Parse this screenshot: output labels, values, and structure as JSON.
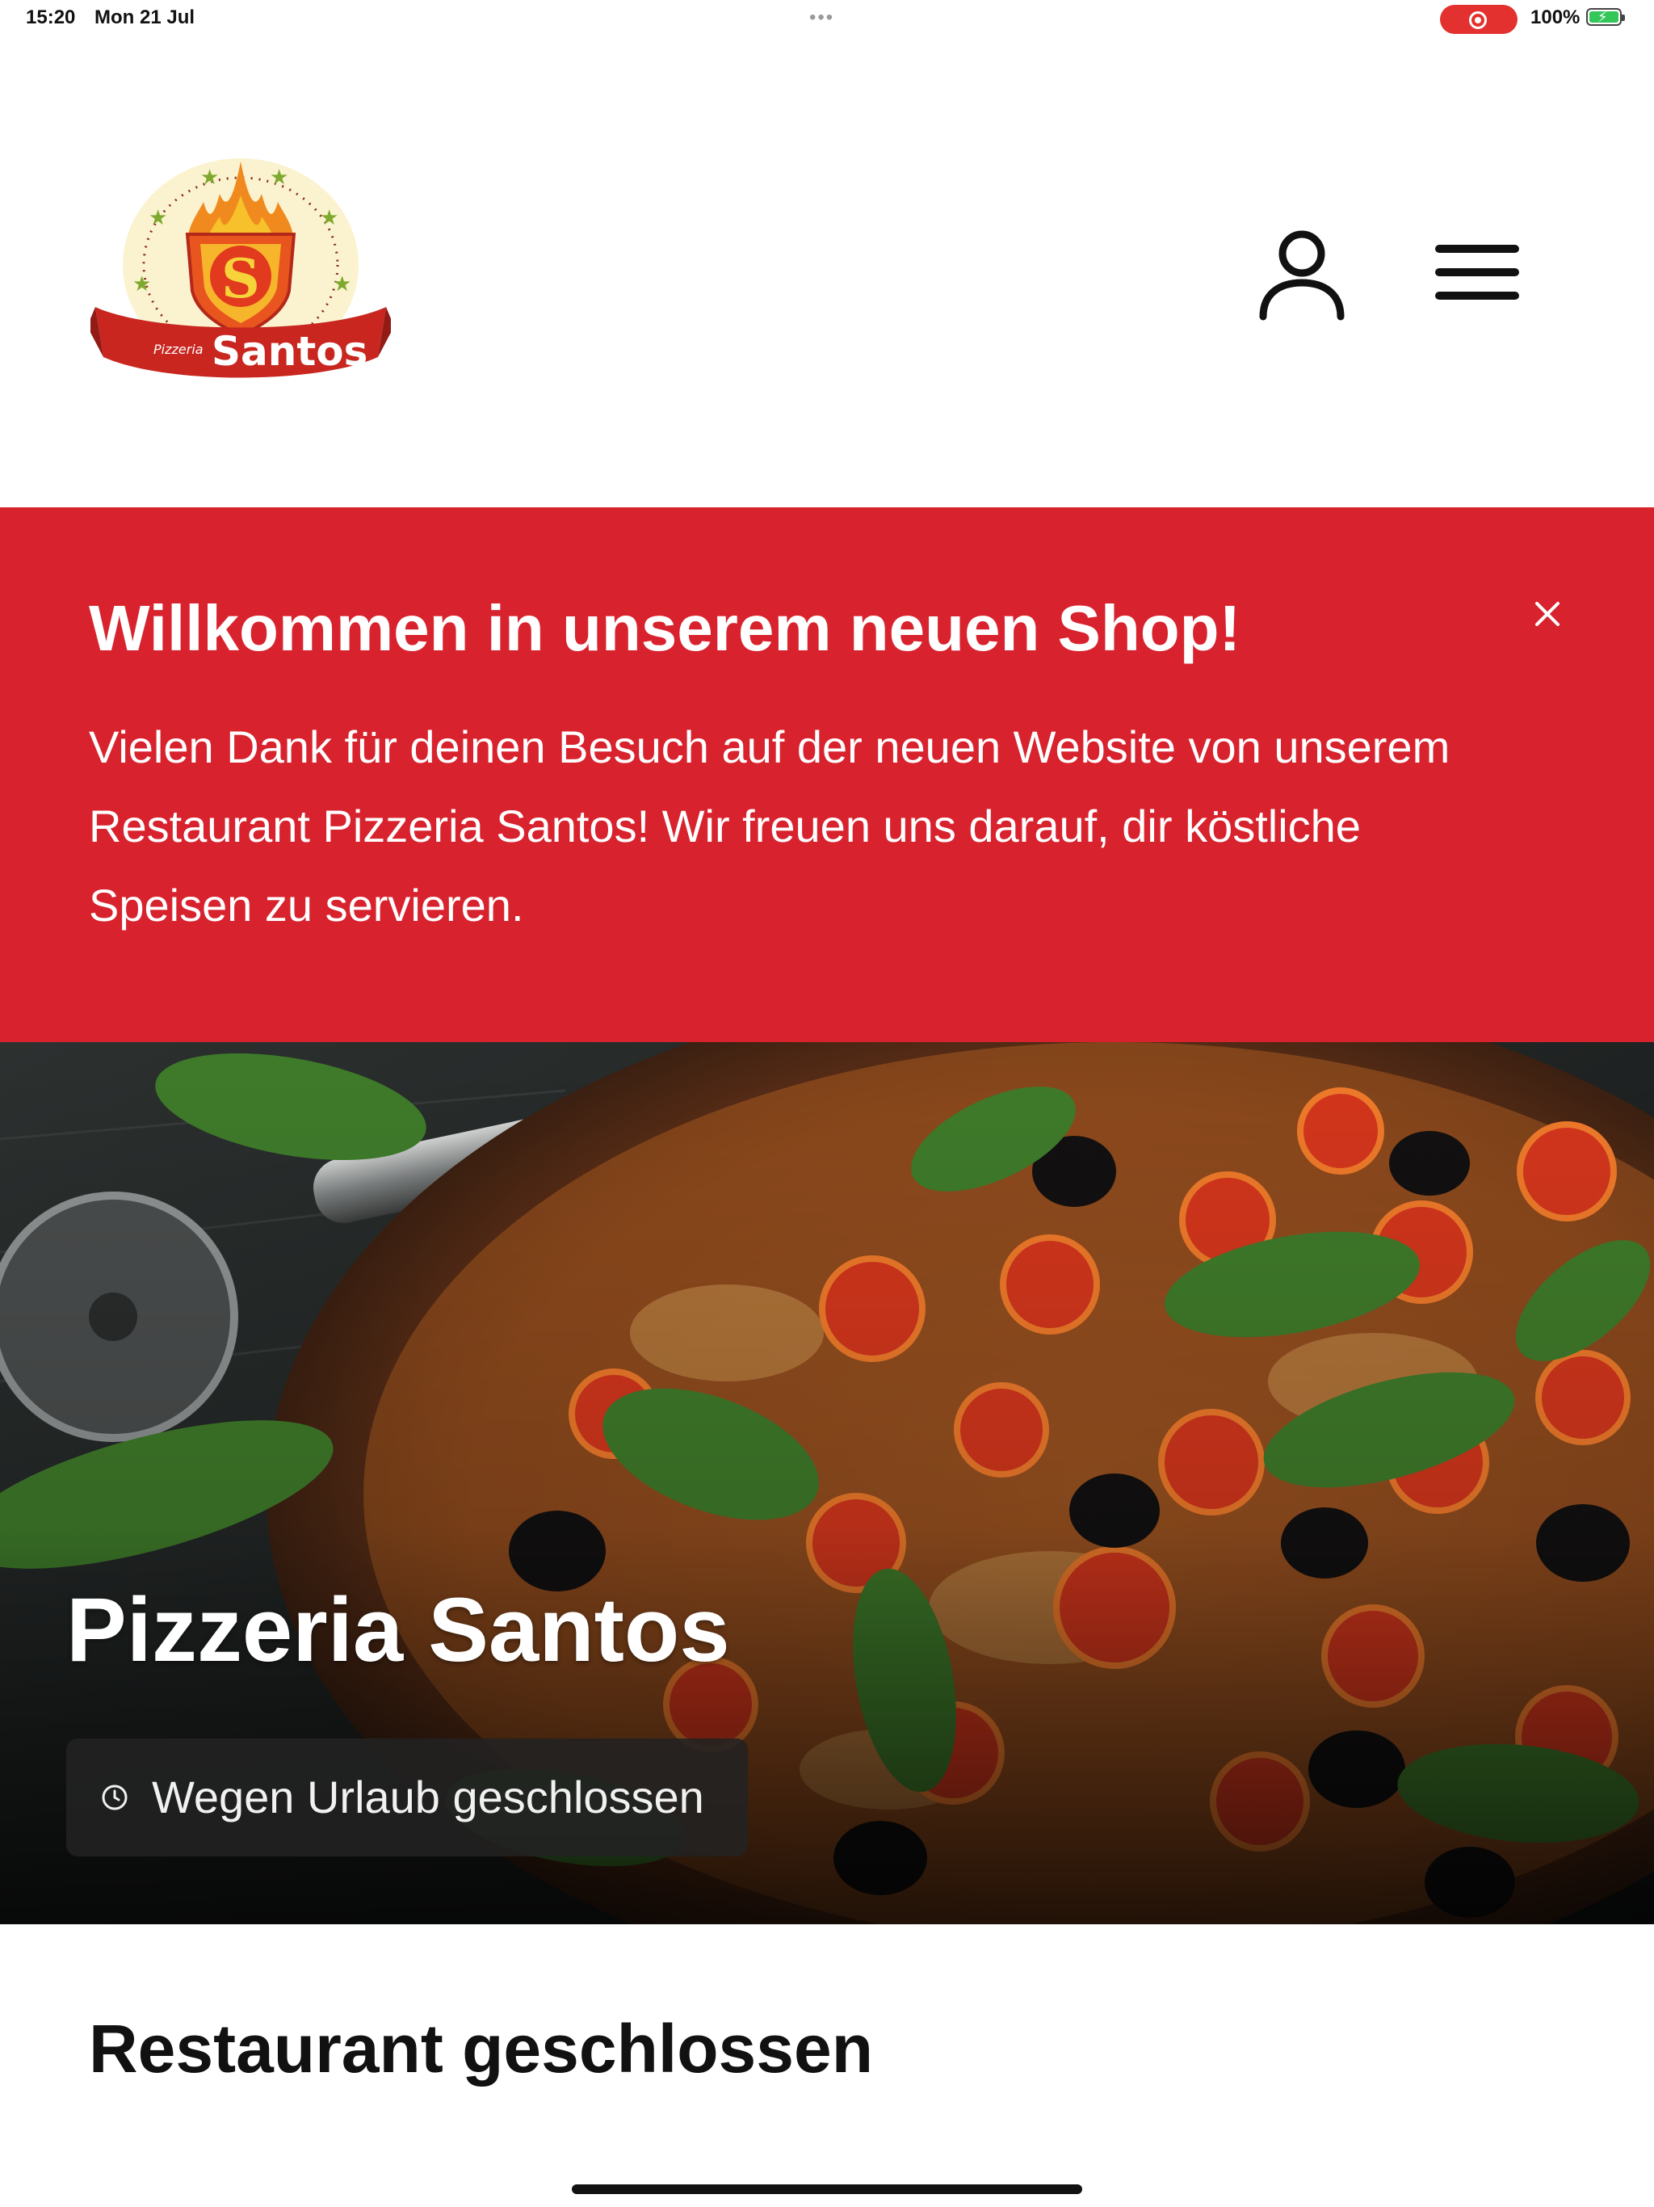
{
  "status_bar": {
    "time": "15:20",
    "date": "Mon 21 Jul",
    "dots": "•••",
    "battery": "100%",
    "record_icon": "screen-record-icon",
    "battery_icon": "battery-charging-icon"
  },
  "header": {
    "logo": {
      "brand": "Santos",
      "subtitle": "Pizzeria"
    },
    "user_icon": "user-icon",
    "menu_icon": "hamburger-menu-icon"
  },
  "banner": {
    "title": "Willkommen in unserem neuen Shop!",
    "body": "Vielen Dank für deinen Besuch auf der neuen Website von unserem Restaurant Pizzeria Santos! Wir freuen uns darauf, dir köstliche Speisen zu servieren.",
    "close_icon": "close-icon"
  },
  "hero": {
    "title": "Pizzeria Santos",
    "status": "Wegen Urlaub geschlossen",
    "status_icon": "clock-icon"
  },
  "main": {
    "heading": "Restaurant geschlossen"
  },
  "colors": {
    "brand_red": "#d8232e",
    "hero_dark": "#1a1c1c",
    "badge_bg": "#222222",
    "record_red": "#e2312f",
    "battery_green": "#33c759"
  }
}
